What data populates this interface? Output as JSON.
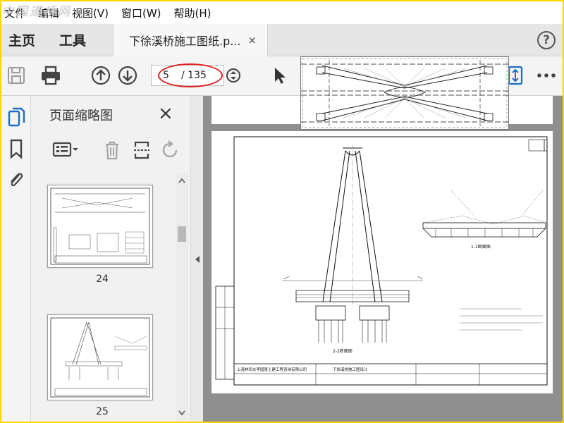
{
  "menu": {
    "items": [
      "文件",
      "编辑",
      "视图(V)",
      "窗口(W)",
      "帮助(H)"
    ]
  },
  "watermark": "中国道桥网",
  "tabs": {
    "home": "主页",
    "tools": "工具",
    "document": "下徐溪桥施工图纸.p...",
    "close": "×",
    "help": "?"
  },
  "toolbar": {
    "current_page": "5",
    "total_pages": "/ 135"
  },
  "thumbnails": {
    "title": "页面缩略图",
    "close": "×",
    "pages": [
      {
        "number": "24"
      },
      {
        "number": "25"
      }
    ]
  },
  "drawing": {
    "section_1": "1-1断面图",
    "section_2": "2-2断面图",
    "company": "上海林同炎李国豪土建工程咨询有限公司",
    "project": "下徐溪桥施工图设计"
  },
  "colors": {
    "accent": "#1b6ec2",
    "highlight_ring": "#e02020"
  }
}
